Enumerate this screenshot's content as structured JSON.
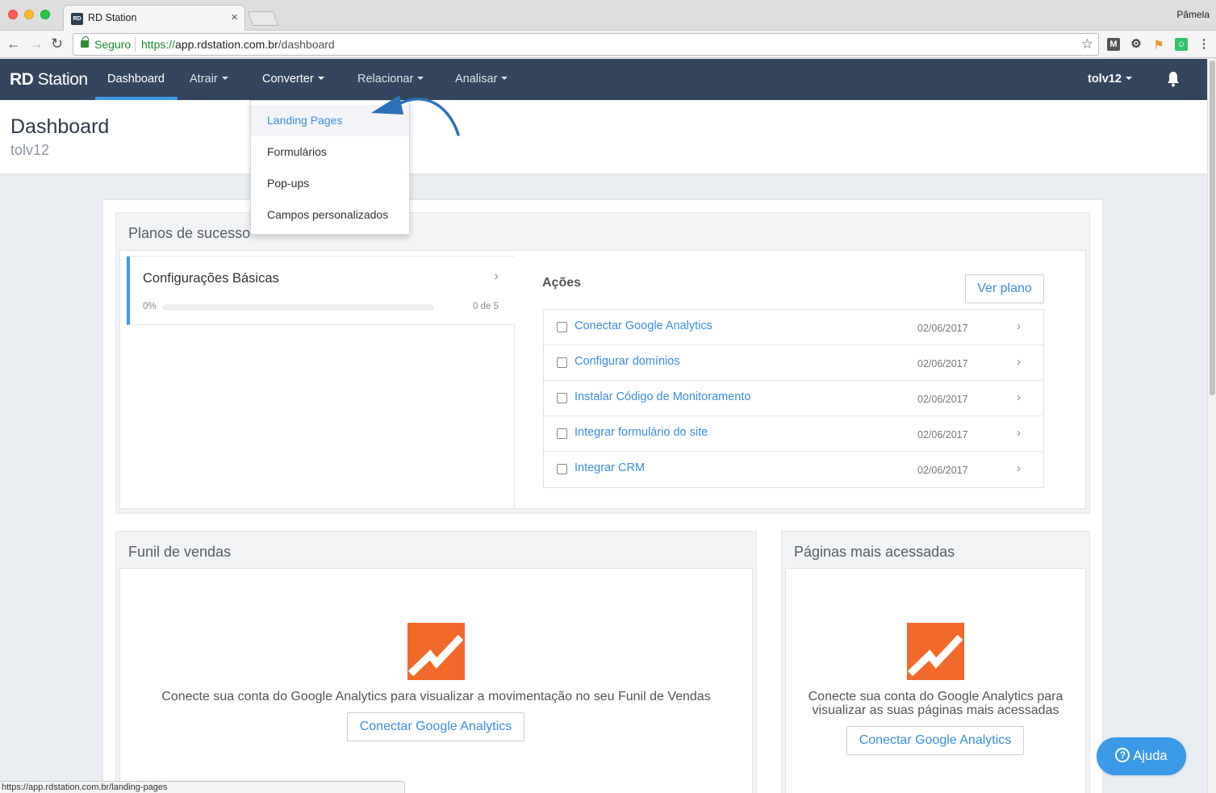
{
  "browser": {
    "tab_title": "RD Station",
    "tab_favicon": "RD",
    "profile_name": "Pâmela",
    "secure_label": "Seguro",
    "url_scheme": "https://",
    "url_host": "app.rdstation.com.br",
    "url_path": "/dashboard",
    "status_url": "https://app.rdstation.com.br/landing-pages"
  },
  "app": {
    "logo_bold": "RD",
    "logo_rest": " Station",
    "nav": {
      "dashboard": "Dashboard",
      "atrair": "Atrair",
      "converter": "Converter",
      "relacionar": "Relacionar",
      "analisar": "Analisar",
      "account": "tolv12"
    },
    "accent_color": "#3a9ae8",
    "nav_bg": "#34465f"
  },
  "dropdown": {
    "items": [
      "Landing Pages",
      "Formulários",
      "Pop-ups",
      "Campos personalizados"
    ],
    "active_index": 0
  },
  "header": {
    "title": "Dashboard",
    "subtitle": "tolv12"
  },
  "success_plans": {
    "title": "Planos de sucesso",
    "step": {
      "title": "Configurações Básicas",
      "progress_label": "0%",
      "progress": 0,
      "count": "0 de 5"
    },
    "actions_title": "Ações",
    "ver_plano": "Ver plano",
    "actions": [
      {
        "label": "Conectar Google Analytics",
        "date": "02/06/2017"
      },
      {
        "label": "Configurar domínios",
        "date": "02/06/2017"
      },
      {
        "label": "Instalar Código de Monitoramento",
        "date": "02/06/2017"
      },
      {
        "label": "Integrar formulário do site",
        "date": "02/06/2017"
      },
      {
        "label": "Integrar CRM",
        "date": "02/06/2017"
      }
    ]
  },
  "funnel": {
    "title": "Funil de vendas",
    "message": "Conecte sua conta do Google Analytics para visualizar a movimentação no seu Funil de Vendas",
    "button": "Conectar Google Analytics"
  },
  "top_pages": {
    "title": "Páginas mais acessadas",
    "message_line1": "Conecte sua conta do Google Analytics para",
    "message_line2": "visualizar as suas páginas mais acessadas",
    "button": "Conectar Google Analytics"
  },
  "help": {
    "label": "Ajuda"
  }
}
